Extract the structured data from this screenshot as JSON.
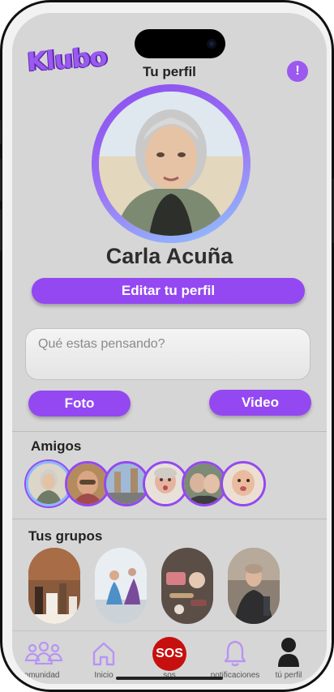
{
  "app": {
    "logo": "Klubo",
    "title": "Tu perfil",
    "alert_icon": "!"
  },
  "profile": {
    "name": "Carla Acuña",
    "edit_label": "Editar tu perfil"
  },
  "post": {
    "placeholder": "Qué estas pensando?",
    "photo_label": "Foto",
    "video_label": "Video"
  },
  "friends": {
    "title": "Amigos",
    "count": 6
  },
  "groups": {
    "title": "Tus grupos",
    "count": 4
  },
  "tabs": [
    {
      "label": "comunidad",
      "icon": "community-icon"
    },
    {
      "label": "Inicio",
      "icon": "home-icon"
    },
    {
      "label": "sos",
      "icon": "sos-icon",
      "badge": "SOS"
    },
    {
      "label": "notificaciones",
      "icon": "bell-icon"
    },
    {
      "label": "tú perfil",
      "icon": "user-icon"
    }
  ],
  "colors": {
    "accent": "#9448f1",
    "sos": "#c80f0f",
    "background": "#d6d6d6"
  }
}
